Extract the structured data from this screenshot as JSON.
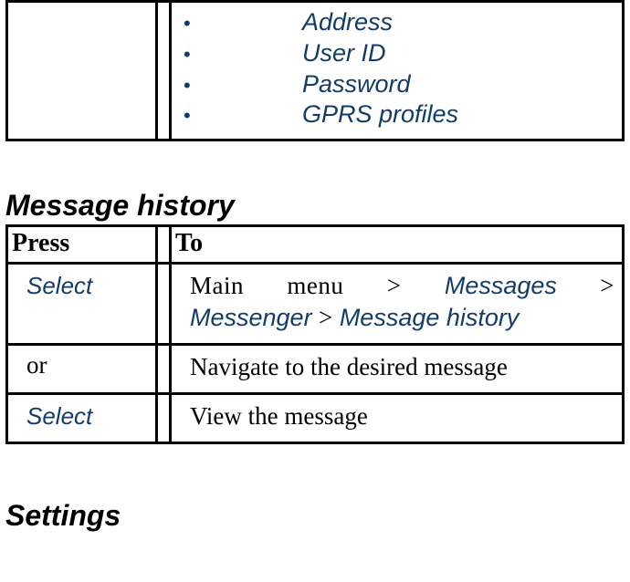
{
  "top_list": {
    "items": [
      {
        "label": "Address"
      },
      {
        "label": "User ID"
      },
      {
        "label": "Password"
      },
      {
        "label": "GPRS profiles"
      }
    ]
  },
  "sections": {
    "message_history": {
      "heading": "Message history",
      "columns": {
        "press": "Press",
        "to": "To"
      },
      "rows": [
        {
          "press_kind": "select",
          "press_label": "Select",
          "to_prefix": "Main menu > ",
          "to_path_1": "Messages",
          "to_sep": " > ",
          "to_path_2": "Messenger",
          "to_sep2": " > ",
          "to_path_3": "Message history"
        },
        {
          "press_kind": "text",
          "press_label": "or",
          "to_text": "Navigate to the desired message"
        },
        {
          "press_kind": "select",
          "press_label": "Select",
          "to_text": "View the message"
        }
      ]
    },
    "settings": {
      "heading": "Settings"
    }
  }
}
